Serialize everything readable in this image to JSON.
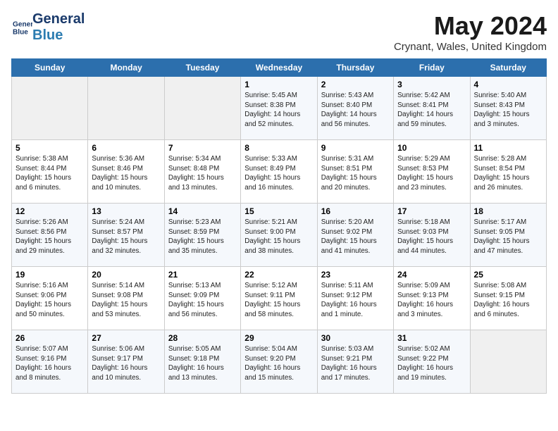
{
  "logo": {
    "line1": "General",
    "line2": "Blue"
  },
  "title": "May 2024",
  "location": "Crynant, Wales, United Kingdom",
  "weekdays": [
    "Sunday",
    "Monday",
    "Tuesday",
    "Wednesday",
    "Thursday",
    "Friday",
    "Saturday"
  ],
  "weeks": [
    [
      {
        "day": "",
        "info": ""
      },
      {
        "day": "",
        "info": ""
      },
      {
        "day": "",
        "info": ""
      },
      {
        "day": "1",
        "info": "Sunrise: 5:45 AM\nSunset: 8:38 PM\nDaylight: 14 hours and 52 minutes."
      },
      {
        "day": "2",
        "info": "Sunrise: 5:43 AM\nSunset: 8:40 PM\nDaylight: 14 hours and 56 minutes."
      },
      {
        "day": "3",
        "info": "Sunrise: 5:42 AM\nSunset: 8:41 PM\nDaylight: 14 hours and 59 minutes."
      },
      {
        "day": "4",
        "info": "Sunrise: 5:40 AM\nSunset: 8:43 PM\nDaylight: 15 hours and 3 minutes."
      }
    ],
    [
      {
        "day": "5",
        "info": "Sunrise: 5:38 AM\nSunset: 8:44 PM\nDaylight: 15 hours and 6 minutes."
      },
      {
        "day": "6",
        "info": "Sunrise: 5:36 AM\nSunset: 8:46 PM\nDaylight: 15 hours and 10 minutes."
      },
      {
        "day": "7",
        "info": "Sunrise: 5:34 AM\nSunset: 8:48 PM\nDaylight: 15 hours and 13 minutes."
      },
      {
        "day": "8",
        "info": "Sunrise: 5:33 AM\nSunset: 8:49 PM\nDaylight: 15 hours and 16 minutes."
      },
      {
        "day": "9",
        "info": "Sunrise: 5:31 AM\nSunset: 8:51 PM\nDaylight: 15 hours and 20 minutes."
      },
      {
        "day": "10",
        "info": "Sunrise: 5:29 AM\nSunset: 8:53 PM\nDaylight: 15 hours and 23 minutes."
      },
      {
        "day": "11",
        "info": "Sunrise: 5:28 AM\nSunset: 8:54 PM\nDaylight: 15 hours and 26 minutes."
      }
    ],
    [
      {
        "day": "12",
        "info": "Sunrise: 5:26 AM\nSunset: 8:56 PM\nDaylight: 15 hours and 29 minutes."
      },
      {
        "day": "13",
        "info": "Sunrise: 5:24 AM\nSunset: 8:57 PM\nDaylight: 15 hours and 32 minutes."
      },
      {
        "day": "14",
        "info": "Sunrise: 5:23 AM\nSunset: 8:59 PM\nDaylight: 15 hours and 35 minutes."
      },
      {
        "day": "15",
        "info": "Sunrise: 5:21 AM\nSunset: 9:00 PM\nDaylight: 15 hours and 38 minutes."
      },
      {
        "day": "16",
        "info": "Sunrise: 5:20 AM\nSunset: 9:02 PM\nDaylight: 15 hours and 41 minutes."
      },
      {
        "day": "17",
        "info": "Sunrise: 5:18 AM\nSunset: 9:03 PM\nDaylight: 15 hours and 44 minutes."
      },
      {
        "day": "18",
        "info": "Sunrise: 5:17 AM\nSunset: 9:05 PM\nDaylight: 15 hours and 47 minutes."
      }
    ],
    [
      {
        "day": "19",
        "info": "Sunrise: 5:16 AM\nSunset: 9:06 PM\nDaylight: 15 hours and 50 minutes."
      },
      {
        "day": "20",
        "info": "Sunrise: 5:14 AM\nSunset: 9:08 PM\nDaylight: 15 hours and 53 minutes."
      },
      {
        "day": "21",
        "info": "Sunrise: 5:13 AM\nSunset: 9:09 PM\nDaylight: 15 hours and 56 minutes."
      },
      {
        "day": "22",
        "info": "Sunrise: 5:12 AM\nSunset: 9:11 PM\nDaylight: 15 hours and 58 minutes."
      },
      {
        "day": "23",
        "info": "Sunrise: 5:11 AM\nSunset: 9:12 PM\nDaylight: 16 hours and 1 minute."
      },
      {
        "day": "24",
        "info": "Sunrise: 5:09 AM\nSunset: 9:13 PM\nDaylight: 16 hours and 3 minutes."
      },
      {
        "day": "25",
        "info": "Sunrise: 5:08 AM\nSunset: 9:15 PM\nDaylight: 16 hours and 6 minutes."
      }
    ],
    [
      {
        "day": "26",
        "info": "Sunrise: 5:07 AM\nSunset: 9:16 PM\nDaylight: 16 hours and 8 minutes."
      },
      {
        "day": "27",
        "info": "Sunrise: 5:06 AM\nSunset: 9:17 PM\nDaylight: 16 hours and 10 minutes."
      },
      {
        "day": "28",
        "info": "Sunrise: 5:05 AM\nSunset: 9:18 PM\nDaylight: 16 hours and 13 minutes."
      },
      {
        "day": "29",
        "info": "Sunrise: 5:04 AM\nSunset: 9:20 PM\nDaylight: 16 hours and 15 minutes."
      },
      {
        "day": "30",
        "info": "Sunrise: 5:03 AM\nSunset: 9:21 PM\nDaylight: 16 hours and 17 minutes."
      },
      {
        "day": "31",
        "info": "Sunrise: 5:02 AM\nSunset: 9:22 PM\nDaylight: 16 hours and 19 minutes."
      },
      {
        "day": "",
        "info": ""
      }
    ]
  ]
}
